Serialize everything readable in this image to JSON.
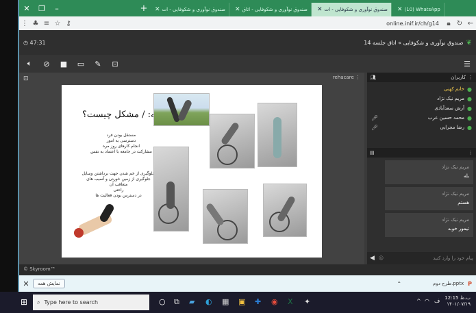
{
  "browser": {
    "tabs": [
      {
        "label": "صندوق نوآوری و شکوفایی - ات",
        "active": false
      },
      {
        "label": "صندوق نوآوری و شکوفایی - اتاق",
        "active": false
      },
      {
        "label": "صندوق نوآوری و شکوفایی - ات",
        "active": true
      },
      {
        "label": "(10) WhatsApp",
        "active": false
      }
    ],
    "url": "online.inif.ir/ch/g14"
  },
  "meeting": {
    "timer": "47:31",
    "room_title": "صندوق نوآوری و شکوفایی » اتاق جلسه 14",
    "presenter": "rehacare",
    "footer": "© Skyroom™"
  },
  "slide": {
    "title": "بیان مساله: / مشکل چیست؟",
    "bullets1": [
      "مستقل بودن فرد",
      "دسترسی به امور",
      "انجام کارهای روز مره",
      "مشارکت در جامعه با اعتماد به نفس"
    ],
    "bullets2": [
      "جلوگیری از خم شدن جهت برداشتن وسایل",
      "جلوگیری از زمین خوردن و آسیب های متعاقب آن",
      "راحتی",
      "در دسترس بودن فعالیت ها"
    ]
  },
  "users_panel": {
    "title": "کاربران",
    "users": [
      {
        "name": "خانم کهنی",
        "me": true,
        "mic": false
      },
      {
        "name": "مریم نیک نژاد",
        "me": false,
        "mic": false
      },
      {
        "name": "آرش سعدآبادی",
        "me": false,
        "mic": false
      },
      {
        "name": "محمد حسین عرب",
        "me": false,
        "mic": true
      },
      {
        "name": "رضا مجرایی",
        "me": false,
        "mic": true
      }
    ]
  },
  "chat": {
    "messages": [
      {
        "sender": "مریم نیک نژاد",
        "text": "بله"
      },
      {
        "sender": "مریم نیک نژاد",
        "text": "هستم"
      },
      {
        "sender": "مریم نیک نژاد",
        "text": "تیمور خوبه"
      }
    ],
    "input_placeholder": "پیام خود را وارد کنید"
  },
  "downloads": {
    "show_all": "نمایش همه",
    "file": "طرح دوم.pptx"
  },
  "taskbar": {
    "search_placeholder": "Type here to search",
    "time": "12:15 ب.ظ",
    "date": "۱۴۰۱/۰۷/۱۹"
  }
}
